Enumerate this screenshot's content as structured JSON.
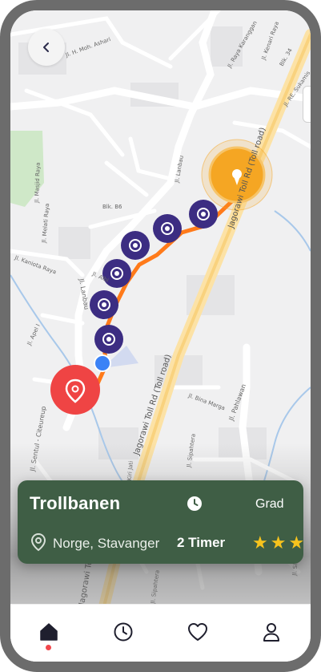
{
  "map": {
    "streets": [
      "Jl. H. Moh. Ashari",
      "Jl. Raya Karanggan",
      "Jl. Kenari Raya",
      "Blk. 34",
      "Jl. RE. Sukamis",
      "Jl. Lanbau",
      "Jagorawi Toll Rd (Toll road)",
      "Jl. Masjid Raya",
      "Jl. Melati Raya",
      "Blk. B6",
      "Jl. Kaniota Raya",
      "Jl. Lanbau",
      "Jl. Albi",
      "Jl. Apel I",
      "Jagorawi Toll Rd (Toll road)",
      "Jl. Bina Marga",
      "Jl. Pahlawan",
      "Jl. Sentul - Citeureup",
      "Jl. Kiri Jati",
      "Jl. Sipahtera",
      "Jagorawi Toll Rd (Toll road)",
      "Jl. Sipahtera",
      "Jl. Sili"
    ],
    "route_color": "#ff7a1a",
    "waypoint_color": "#3c2d82",
    "destination_color": "#f5a623",
    "start_color": "#ef4444",
    "user_dot_color": "#3b82f6"
  },
  "card": {
    "title": "Trollbanen",
    "grade_label": "Grad",
    "location": "Norge, Stavanger",
    "duration": "2 Timer",
    "rating": 3,
    "star": "★",
    "background": "#3f5e45"
  },
  "tabs": [
    {
      "icon": "home-icon",
      "active": true
    },
    {
      "icon": "clock-icon",
      "active": false
    },
    {
      "icon": "heart-icon",
      "active": false
    },
    {
      "icon": "profile-icon",
      "active": false
    }
  ],
  "colors": {
    "active_dot": "#f2474c",
    "frame": "#6c6c6c"
  }
}
